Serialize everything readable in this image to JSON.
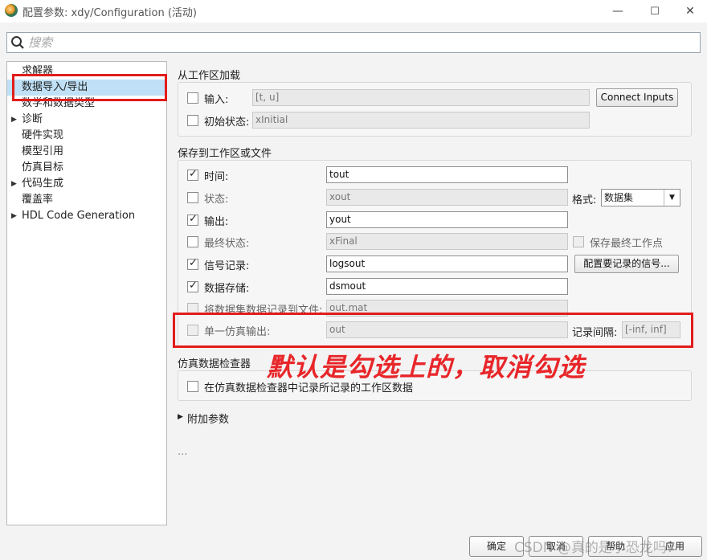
{
  "window": {
    "title": "配置参数: xdy/Configuration (活动)",
    "minimize": "—",
    "maximize": "☐",
    "close": "✕"
  },
  "search": {
    "placeholder": "搜索"
  },
  "tree": {
    "items": [
      {
        "label": "求解器",
        "expandable": false,
        "selected": false
      },
      {
        "label": "数据导入/导出",
        "expandable": false,
        "selected": true
      },
      {
        "label": "数学和数据类型",
        "expandable": false,
        "selected": false
      },
      {
        "label": "诊断",
        "expandable": true,
        "selected": false
      },
      {
        "label": "硬件实现",
        "expandable": false,
        "selected": false
      },
      {
        "label": "模型引用",
        "expandable": false,
        "selected": false
      },
      {
        "label": "仿真目标",
        "expandable": false,
        "selected": false
      },
      {
        "label": "代码生成",
        "expandable": true,
        "selected": false
      },
      {
        "label": "覆盖率",
        "expandable": false,
        "selected": false
      },
      {
        "label": "HDL Code Generation",
        "expandable": true,
        "selected": false
      }
    ],
    "expand_arrow": "▶"
  },
  "load": {
    "title": "从工作区加载",
    "input_label": "输入:",
    "input_value": "[t, u]",
    "input_checked": false,
    "connect_button": "Connect Inputs",
    "initial_label": "初始状态:",
    "initial_value": "xInitial",
    "initial_checked": false
  },
  "save": {
    "title": "保存到工作区或文件",
    "rows": [
      {
        "label": "时间:",
        "value": "tout",
        "checked": true,
        "enabled": true
      },
      {
        "label": "状态:",
        "value": "xout",
        "checked": false,
        "enabled": false
      },
      {
        "label": "输出:",
        "value": "yout",
        "checked": true,
        "enabled": true
      },
      {
        "label": "最终状态:",
        "value": "xFinal",
        "checked": false,
        "enabled": false
      },
      {
        "label": "信号记录:",
        "value": "logsout",
        "checked": true,
        "enabled": true
      },
      {
        "label": "数据存储:",
        "value": "dsmout",
        "checked": true,
        "enabled": true
      },
      {
        "label": "将数据集数据记录到文件:",
        "value": "out.mat",
        "checked": false,
        "enabled": false
      },
      {
        "label": "单一仿真输出:",
        "value": "out",
        "checked": false,
        "enabled": false
      }
    ],
    "format_label": "格式:",
    "format_value": "数据集",
    "save_final_op_label": "保存最终工作点",
    "configure_signals_button": "配置要记录的信号...",
    "log_interval_label": "记录间隔:",
    "log_interval_value": "[-inf, inf]"
  },
  "inspector": {
    "title": "仿真数据检查器",
    "checkbox_label": "在仿真数据检查器中记录所记录的工作区数据",
    "checked": false
  },
  "additional": {
    "label": "附加参数",
    "arrow": "▶"
  },
  "ellipsis": "...",
  "annotation": "默认是勾选上的，取消勾选",
  "footer": {
    "ok": "确定",
    "cancel": "取消",
    "help": "帮助",
    "apply": "应用",
    "watermark": "CSDN @真的是小恐龙吗？"
  },
  "colors": {
    "highlight": "#e21c1c",
    "selected_bg": "#bfe0f6"
  }
}
